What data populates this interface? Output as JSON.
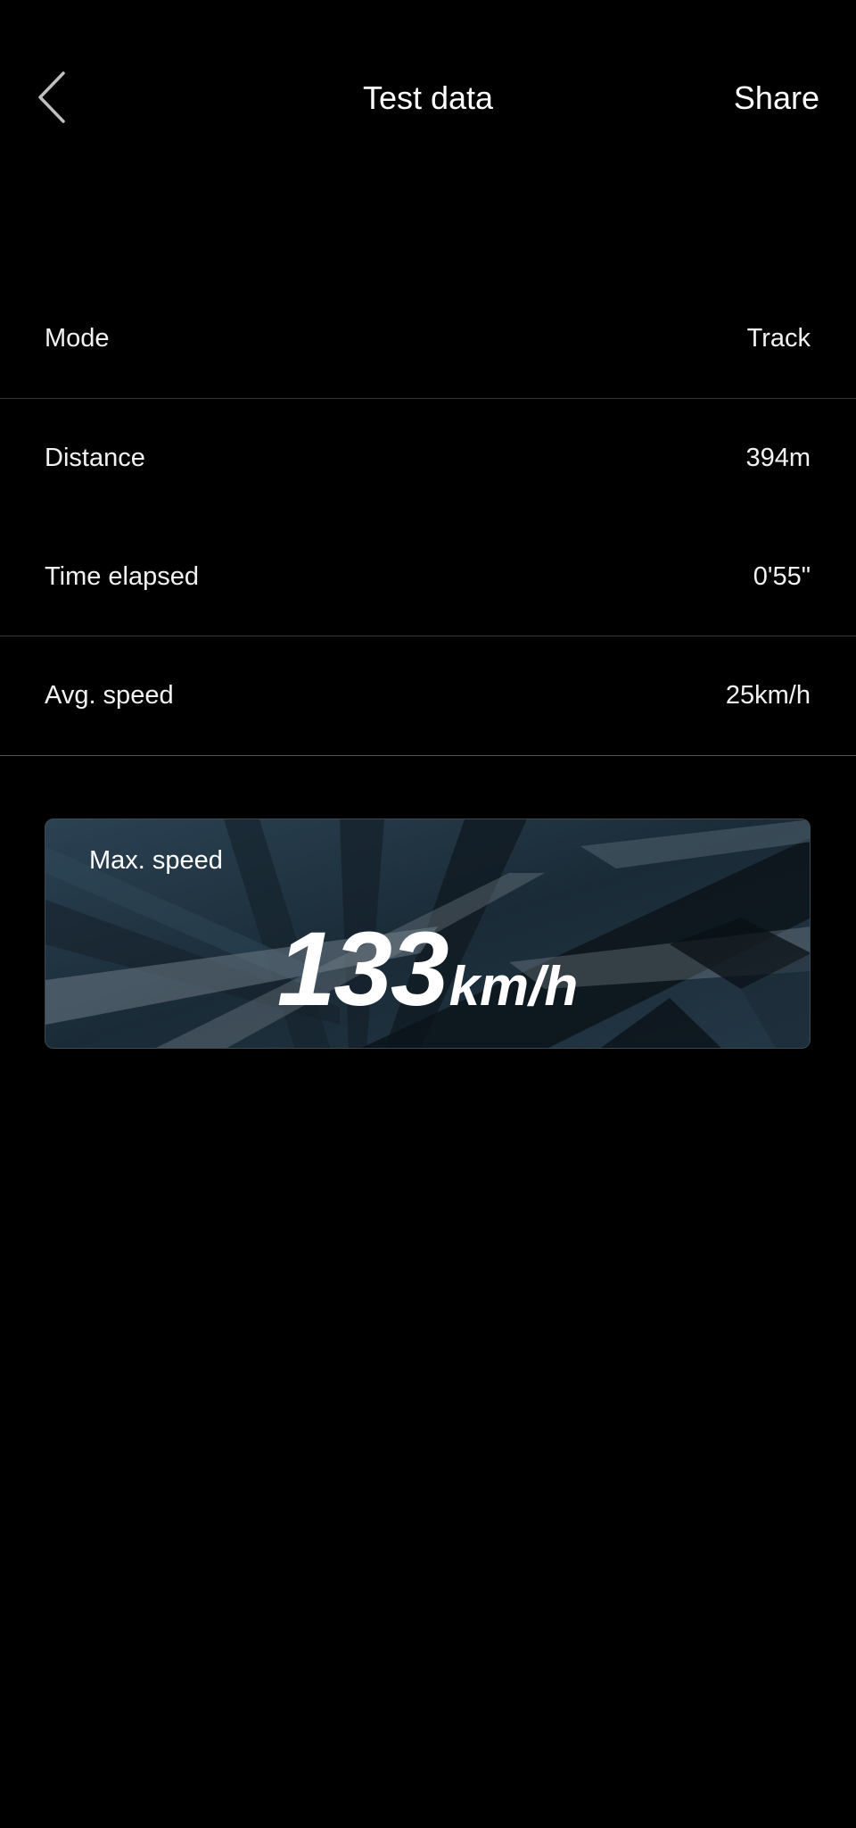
{
  "header": {
    "title": "Test data",
    "share_label": "Share",
    "back_icon": "chevron-left-icon"
  },
  "stats": [
    {
      "label": "Mode",
      "value": "Track"
    },
    {
      "label": "Distance",
      "value": "394m"
    },
    {
      "label": "Time elapsed",
      "value": "0'55\""
    },
    {
      "label": "Avg. speed",
      "value": "25km/h"
    }
  ],
  "max_speed": {
    "label": "Max. speed",
    "value": "133",
    "unit": "km/h"
  },
  "colors": {
    "background": "#000000",
    "text": "#ffffff",
    "divider": "#3a3a3a",
    "card_base": "#1e2f3b"
  }
}
